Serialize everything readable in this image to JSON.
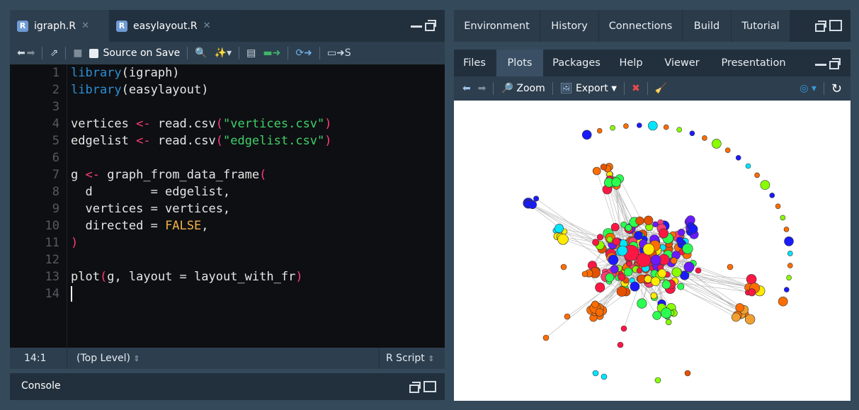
{
  "source_pane": {
    "tabs": [
      {
        "label": "igraph.R",
        "active": true
      },
      {
        "label": "easylayout.R",
        "active": false
      }
    ],
    "toolbar": {
      "source_on_save_label": "Source on Save",
      "source_label": "S"
    },
    "editor": {
      "line_numbers": [
        "1",
        "2",
        "3",
        "4",
        "5",
        "6",
        "7",
        "8",
        "9",
        "10",
        "11",
        "12",
        "13",
        "14"
      ],
      "code_lines": [
        {
          "parts": [
            {
              "t": "library",
              "c": "kw-fn"
            },
            {
              "t": "(igraph)",
              "c": ""
            }
          ]
        },
        {
          "parts": [
            {
              "t": "library",
              "c": "kw-fn"
            },
            {
              "t": "(easylayout)",
              "c": ""
            }
          ]
        },
        {
          "parts": []
        },
        {
          "parts": [
            {
              "t": "vertices ",
              "c": ""
            },
            {
              "t": "<-",
              "c": "op"
            },
            {
              "t": " read.csv",
              "c": ""
            },
            {
              "t": "(",
              "c": "paren"
            },
            {
              "t": "\"vertices.csv\"",
              "c": "str"
            },
            {
              "t": ")",
              "c": "paren"
            }
          ]
        },
        {
          "parts": [
            {
              "t": "edgelist ",
              "c": ""
            },
            {
              "t": "<-",
              "c": "op"
            },
            {
              "t": " read.csv",
              "c": ""
            },
            {
              "t": "(",
              "c": "paren"
            },
            {
              "t": "\"edgelist.csv\"",
              "c": "str"
            },
            {
              "t": ")",
              "c": "paren"
            }
          ]
        },
        {
          "parts": []
        },
        {
          "parts": [
            {
              "t": "g ",
              "c": ""
            },
            {
              "t": "<-",
              "c": "op"
            },
            {
              "t": " graph_from_data_frame",
              "c": ""
            },
            {
              "t": "(",
              "c": "paren"
            }
          ]
        },
        {
          "parts": [
            {
              "t": "  d        = edgelist,",
              "c": ""
            }
          ]
        },
        {
          "parts": [
            {
              "t": "  vertices = vertices,",
              "c": ""
            }
          ]
        },
        {
          "parts": [
            {
              "t": "  directed = ",
              "c": ""
            },
            {
              "t": "FALSE",
              "c": "bool"
            },
            {
              "t": ",",
              "c": ""
            }
          ]
        },
        {
          "parts": [
            {
              "t": ")",
              "c": "paren"
            }
          ]
        },
        {
          "parts": []
        },
        {
          "parts": [
            {
              "t": "plot",
              "c": ""
            },
            {
              "t": "(",
              "c": "paren"
            },
            {
              "t": "g, layout = layout_with_fr",
              "c": ""
            },
            {
              "t": ")",
              "c": "paren"
            }
          ]
        },
        {
          "parts": []
        }
      ]
    },
    "status": {
      "position": "14:1",
      "scope": "(Top Level)",
      "filetype": "R Script"
    }
  },
  "console": {
    "label": "Console"
  },
  "env_pane": {
    "tabs": [
      "Environment",
      "History",
      "Connections",
      "Build",
      "Tutorial"
    ]
  },
  "files_pane": {
    "tabs": [
      "Files",
      "Plots",
      "Packages",
      "Help",
      "Viewer",
      "Presentation"
    ],
    "active_tab": "Plots",
    "toolbar": {
      "zoom_label": "Zoom",
      "export_label": "Export"
    }
  },
  "colors": {
    "pane_bg": "#22303d",
    "editor_bg": "#0e0f12",
    "function": "#2b8fd6",
    "string": "#3fd06a",
    "operator": "#ff3d74",
    "boolean": "#f0b24a"
  }
}
